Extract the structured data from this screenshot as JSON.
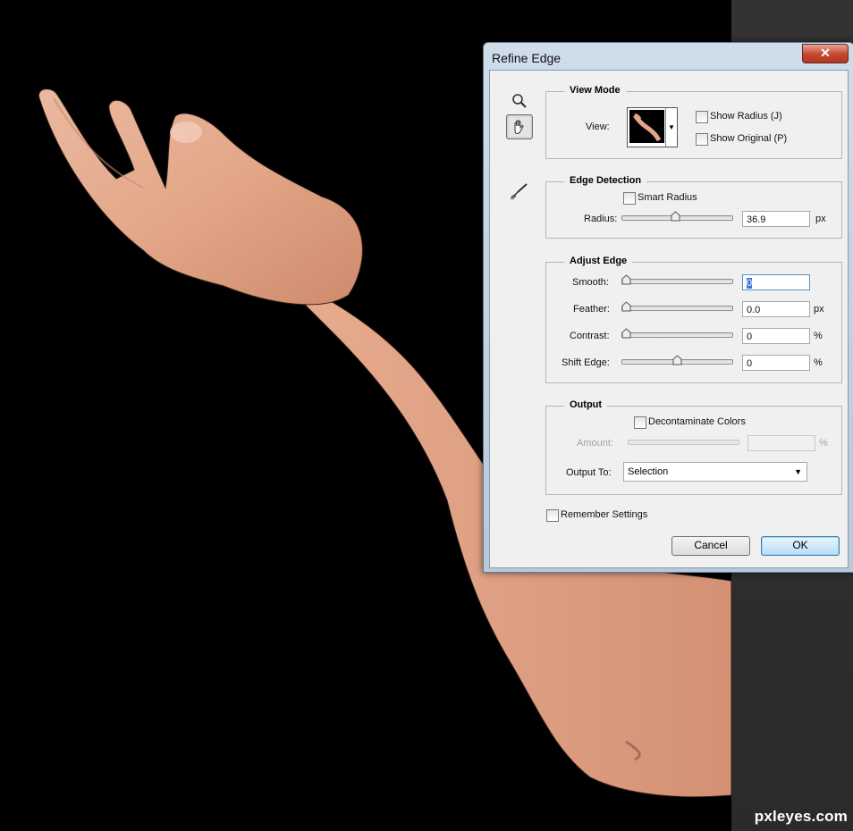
{
  "dialog": {
    "title": "Refine Edge",
    "close_glyph": "✕",
    "tools": [
      {
        "icon": "zoom-icon"
      },
      {
        "icon": "hand-icon",
        "selected": true
      },
      {
        "icon": "refine-radius-brush-icon"
      }
    ],
    "view_mode": {
      "title": "View Mode",
      "view_label": "View:",
      "show_radius": {
        "label": "Show Radius (J)",
        "checked": false
      },
      "show_original": {
        "label": "Show Original (P)",
        "checked": false
      }
    },
    "edge_detection": {
      "title": "Edge Detection",
      "smart_radius": {
        "label": "Smart Radius",
        "checked": false
      },
      "radius": {
        "label": "Radius:",
        "value": "36.9",
        "unit": "px",
        "level": 0.49
      }
    },
    "adjust_edge": {
      "title": "Adjust Edge",
      "smooth": {
        "label": "Smooth:",
        "value_selected": "0",
        "unit": "",
        "level": 0.0
      },
      "feather": {
        "label": "Feather:",
        "value": "0.0",
        "unit": "px",
        "level": 0.0
      },
      "contrast": {
        "label": "Contrast:",
        "value": "0",
        "unit": "%",
        "level": 0.0
      },
      "shift_edge": {
        "label": "Shift Edge:",
        "value": "0",
        "unit": "%",
        "level": 0.5
      }
    },
    "output": {
      "title": "Output",
      "decontaminate": {
        "label": "Decontaminate Colors",
        "checked": false
      },
      "amount": {
        "label": "Amount:",
        "value": "",
        "unit": "%",
        "disabled": true
      },
      "output_to": {
        "label": "Output To:",
        "selected": "Selection"
      }
    },
    "remember_settings": {
      "label": "Remember Settings",
      "checked": false
    },
    "buttons": {
      "cancel": "Cancel",
      "ok": "OK"
    }
  },
  "watermark": "pxleyes.com"
}
